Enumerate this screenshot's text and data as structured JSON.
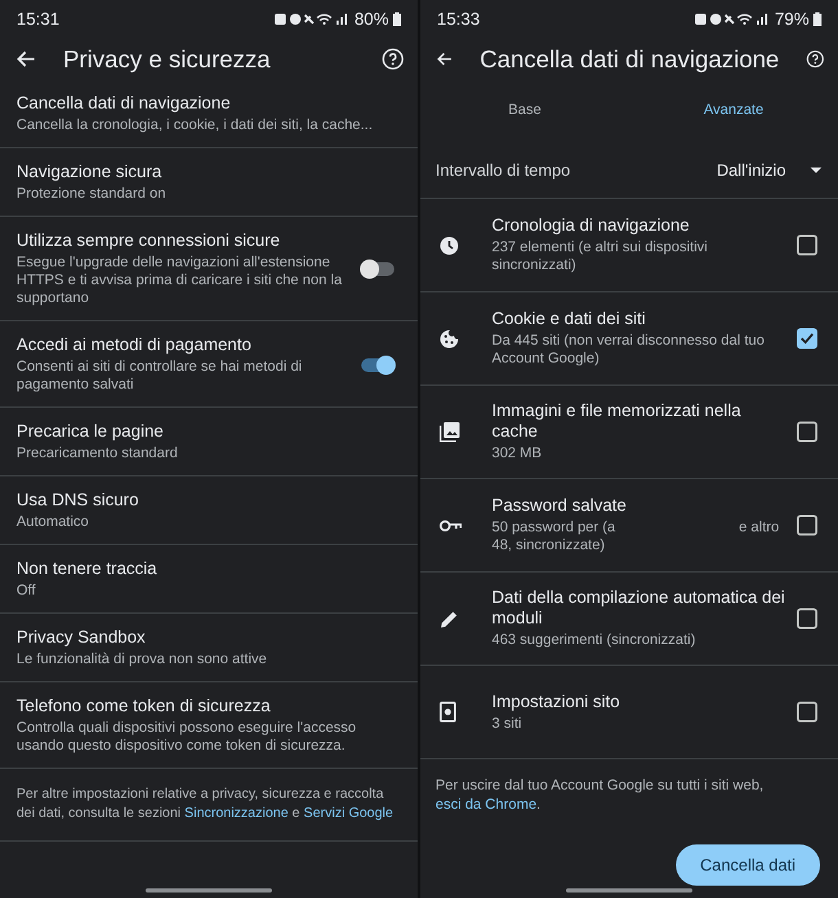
{
  "screens": [
    {
      "status_bar": {
        "time": "15:31",
        "battery": "80%"
      },
      "app_bar": {
        "title": "Privacy e sicurezza"
      },
      "settings": [
        {
          "title": "Cancella dati di navigazione",
          "subtitle": "Cancella la cronologia, i cookie, i dati dei siti, la cache...",
          "kind": "text"
        },
        {
          "title": "Navigazione sicura",
          "subtitle": "Protezione standard on",
          "kind": "text"
        },
        {
          "title": "Utilizza sempre connessioni sicure",
          "subtitle": "Esegue l'upgrade delle navigazioni all'estensione HTTPS e ti avvisa prima di caricare i siti che non la supportano",
          "kind": "toggle",
          "on": false
        },
        {
          "title": "Accedi ai metodi di pagamento",
          "subtitle": "Consenti ai siti di controllare se hai metodi di pagamento salvati",
          "kind": "toggle",
          "on": true
        },
        {
          "title": "Precarica le pagine",
          "subtitle": "Precaricamento standard",
          "kind": "text"
        },
        {
          "title": "Usa DNS sicuro",
          "subtitle": "Automatico",
          "kind": "text"
        },
        {
          "title": "Non tenere traccia",
          "subtitle": "Off",
          "kind": "text"
        },
        {
          "title": "Privacy Sandbox",
          "subtitle": "Le funzionalità di prova non sono attive",
          "kind": "text"
        },
        {
          "title": "Telefono come token di sicurezza",
          "subtitle": "Controlla quali dispositivi possono eseguire l'accesso usando questo dispositivo come token di sicurezza.",
          "kind": "text"
        }
      ],
      "footer": [
        {
          "kind": "text",
          "text": "Per altre impostazioni relative a privacy, sicurezza e raccolta dei dati, consulta le sezioni "
        },
        {
          "kind": "link",
          "text": "Sincronizzazione"
        },
        {
          "kind": "text",
          "text": " e "
        },
        {
          "kind": "link",
          "text": "Servizi Google"
        }
      ]
    },
    {
      "status_bar": {
        "time": "15:33",
        "battery": "79%"
      },
      "app_bar": {
        "title": "Cancella dati di navigazione"
      },
      "tabs": [
        {
          "label": "Base",
          "selected": false
        },
        {
          "label": "Avanzate",
          "selected": true
        }
      ],
      "time_range": {
        "label": "Intervallo di tempo",
        "value": "Dall'inizio"
      },
      "data_types": [
        {
          "title": "Cronologia di navigazione",
          "subtitle": [
            "237 elementi (e altri sui dispositivi sincronizzati)"
          ],
          "checked": false
        },
        {
          "title": "Cookie e dati dei siti",
          "subtitle": [
            "Da 445 siti (non verrai disconnesso dal tuo Account Google)"
          ],
          "checked": true
        },
        {
          "title": "Immagini e file memorizzati nella cache",
          "subtitle": [
            "302 MB"
          ],
          "checked": false
        },
        {
          "title": "Password salvate",
          "subtitle": [
            "50 password per (a",
            "e altro 48, sincronizzate)"
          ],
          "checked": false
        },
        {
          "title": "Dati della compilazione automatica dei moduli",
          "subtitle": [
            "463 suggerimenti (sincronizzati)"
          ],
          "checked": false
        },
        {
          "title": "Impostazioni sito",
          "subtitle": [
            "3 siti"
          ],
          "checked": false
        }
      ],
      "footer": [
        {
          "kind": "text",
          "text": "Per uscire dal tuo Account Google su tutti i siti web, "
        },
        {
          "kind": "link",
          "text": "esci da Chrome"
        },
        {
          "kind": "text",
          "text": "."
        }
      ],
      "primary_button": "Cancella dati"
    }
  ]
}
